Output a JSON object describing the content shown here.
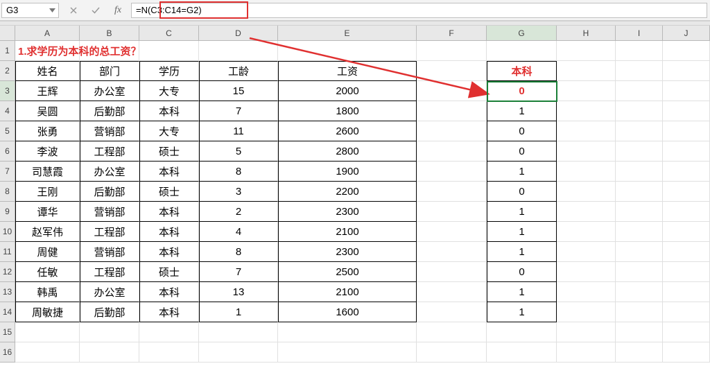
{
  "nameBox": "G3",
  "formula": "=N(C3:C14=G2)",
  "columns": [
    "A",
    "B",
    "C",
    "D",
    "E",
    "F",
    "G",
    "H",
    "I",
    "J"
  ],
  "titleRow": "1.求学历为本科的总工资？",
  "headers": [
    "姓名",
    "部门",
    "学历",
    "工龄",
    "工资"
  ],
  "data": [
    {
      "name": "王辉",
      "dept": "办公室",
      "edu": "大专",
      "years": "15",
      "salary": "2000"
    },
    {
      "name": "吴圆",
      "dept": "后勤部",
      "edu": "本科",
      "years": "7",
      "salary": "1800"
    },
    {
      "name": "张勇",
      "dept": "营销部",
      "edu": "大专",
      "years": "11",
      "salary": "2600"
    },
    {
      "name": "李波",
      "dept": "工程部",
      "edu": "硕士",
      "years": "5",
      "salary": "2800"
    },
    {
      "name": "司慧霞",
      "dept": "办公室",
      "edu": "本科",
      "years": "8",
      "salary": "1900"
    },
    {
      "name": "王刚",
      "dept": "后勤部",
      "edu": "硕士",
      "years": "3",
      "salary": "2200"
    },
    {
      "name": "谭华",
      "dept": "营销部",
      "edu": "本科",
      "years": "2",
      "salary": "2300"
    },
    {
      "name": "赵军伟",
      "dept": "工程部",
      "edu": "本科",
      "years": "4",
      "salary": "2100"
    },
    {
      "name": "周健",
      "dept": "营销部",
      "edu": "本科",
      "years": "8",
      "salary": "2300"
    },
    {
      "name": "任敏",
      "dept": "工程部",
      "edu": "硕士",
      "years": "7",
      "salary": "2500"
    },
    {
      "name": "韩禹",
      "dept": "办公室",
      "edu": "本科",
      "years": "13",
      "salary": "2100"
    },
    {
      "name": "周敏捷",
      "dept": "后勤部",
      "edu": "本科",
      "years": "1",
      "salary": "1600"
    }
  ],
  "g2": "本科",
  "gvals": [
    "0",
    "1",
    "0",
    "0",
    "1",
    "0",
    "1",
    "1",
    "1",
    "0",
    "1",
    "1"
  ],
  "rowLabels": [
    "1",
    "2",
    "3",
    "4",
    "5",
    "6",
    "7",
    "8",
    "9",
    "10",
    "11",
    "12",
    "13",
    "14",
    "15",
    "16"
  ]
}
